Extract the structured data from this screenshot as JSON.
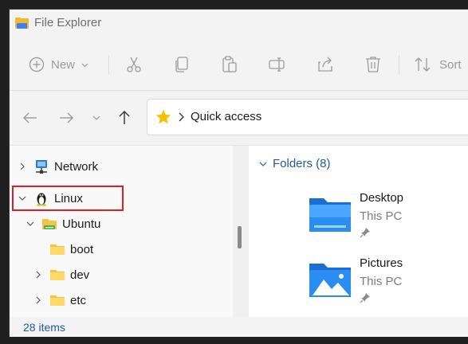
{
  "window": {
    "title": "File Explorer"
  },
  "toolbar": {
    "new_label": "New",
    "sort_label": "Sort",
    "icons": [
      "add-icon",
      "cut-icon",
      "copy-icon",
      "paste-icon",
      "rename-icon",
      "share-icon",
      "delete-icon",
      "sort-icon"
    ]
  },
  "address": {
    "location": "Quick access"
  },
  "tree": {
    "items": [
      {
        "label": "Network",
        "icon": "network-icon",
        "expanded": false
      },
      {
        "label": "Linux",
        "icon": "linux-penguin-icon",
        "expanded": true,
        "highlighted": true
      },
      {
        "label": "Ubuntu",
        "icon": "drive-folder-icon",
        "expanded": true
      },
      {
        "label": "boot",
        "icon": "folder-icon"
      },
      {
        "label": "dev",
        "icon": "folder-icon",
        "expanded": false
      },
      {
        "label": "etc",
        "icon": "folder-icon",
        "expanded": false
      }
    ],
    "highlight_color": "#e02020"
  },
  "pane": {
    "group_title": "Folders (8)",
    "folders": [
      {
        "name": "Desktop",
        "location": "This PC",
        "pinned": true
      },
      {
        "name": "Pictures",
        "location": "This PC",
        "pinned": true
      }
    ]
  },
  "status": {
    "items_count": "28 items"
  },
  "colors": {
    "accent": "#1f5a9e",
    "folder": "#f5c242",
    "highlight": "#e02020"
  }
}
